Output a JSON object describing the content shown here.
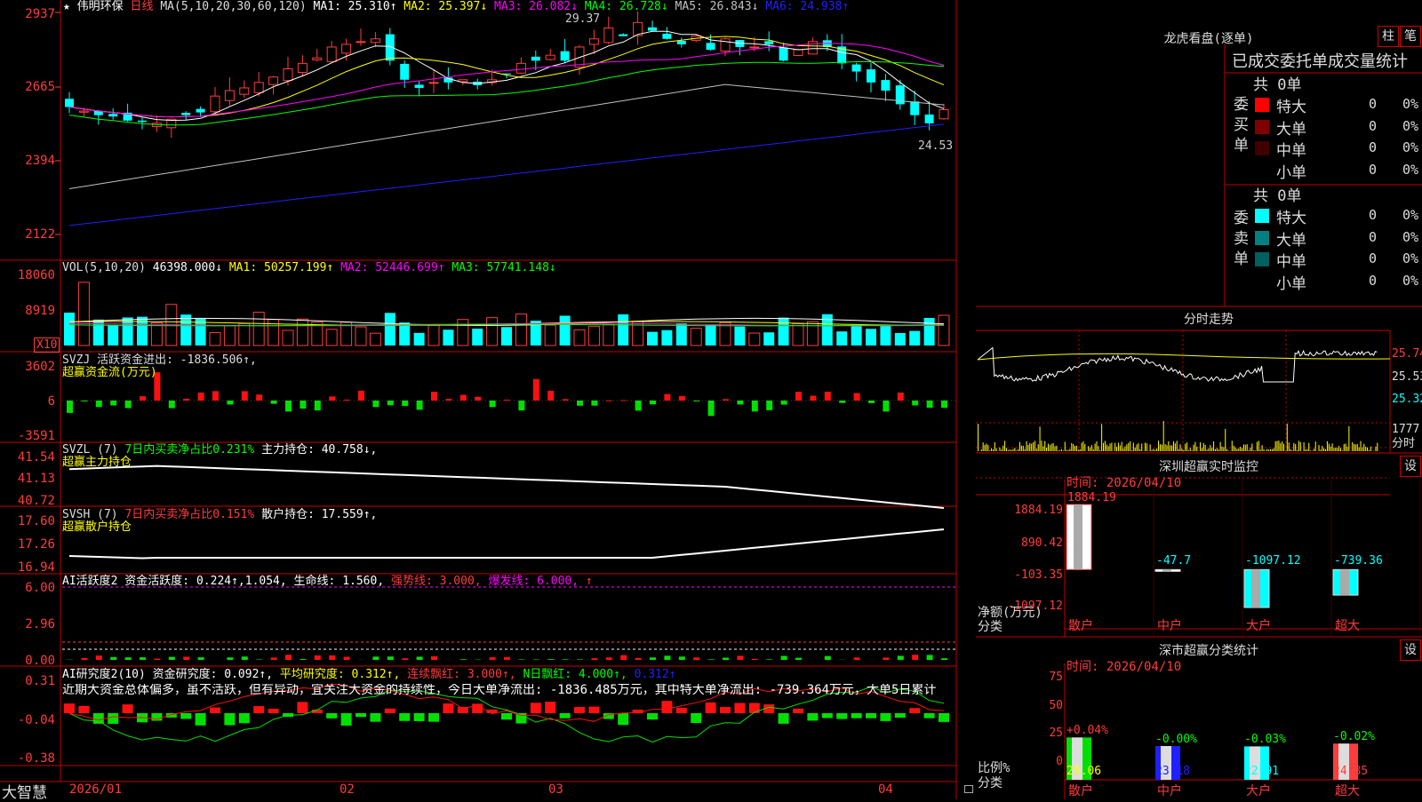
{
  "header": {
    "star": "★",
    "name": "伟明环保",
    "period": "日线",
    "ma_label": "MA(5,10,20,30,60,120)",
    "ma": [
      {
        "t": "MA1: 25.310↑",
        "c": "#ffffff"
      },
      {
        "t": "MA2: 25.397↓",
        "c": "#ffff00"
      },
      {
        "t": "MA3: 26.082↓",
        "c": "#ff00ff"
      },
      {
        "t": "MA4: 26.728↓",
        "c": "#00ff00"
      },
      {
        "t": "MA5: 26.843↓",
        "c": "#c0c0c0"
      },
      {
        "t": "MA6: 24.938↑",
        "c": "#2020ff"
      }
    ]
  },
  "price_axis": [
    "2937",
    "2665",
    "2394",
    "2122"
  ],
  "annot": {
    "high": "29.37",
    "low": "24.53"
  },
  "vol": {
    "label": "VOL(5,10,20)",
    "val": "46398.000↓",
    "ma1": "MA1: 50257.199↑",
    "ma2": "MA2: 52446.699↑",
    "ma3": "MA3: 57741.148↓",
    "axis": [
      "18060",
      "8919"
    ],
    "unit": "X10"
  },
  "svzj": {
    "l1": "SVZJ  活跃资金进出: -1836.506↑,",
    "l2": "超赢资金流(万元)",
    "axis": [
      "3602",
      "6",
      "-3591"
    ]
  },
  "svzl": {
    "l1a": "SVZL (7)",
    "l1b": "7日内买卖净占比0.231%",
    "l1c": "主力持仓: 40.758↓,",
    "l2": "超赢主力持仓",
    "axis": [
      "41.54",
      "41.13",
      "40.72"
    ]
  },
  "svsh": {
    "l1a": "SVSH (7)",
    "l1b": "7日内买卖净占比0.151%",
    "l1c": "散户持仓: 17.559↑,",
    "l2": "超赢散户持仓",
    "axis": [
      "17.60",
      "17.26",
      "16.94"
    ]
  },
  "ai1": {
    "l1": "AI活跃度2 资金活跃度: 0.224↑,1.054,",
    "l1b": "生命线: 1.560,",
    "l1c": "强势线: 3.000,",
    "l1d": "爆发线: 6.000,",
    "l1e": "↑",
    "axis": [
      "6.00",
      "2.96",
      "0.00"
    ]
  },
  "ai2": {
    "l1": "AI研究度2(10) 资金研究度: 0.092↑,",
    "l1b": "平均研究度: 0.312↑,",
    "l1c": "连续飘红: 3.000↑,",
    "l1d": "N日飘红: 4.000↑,",
    "l1e": "0.312↑",
    "text": "近期大资金总体偏多，虽不活跃，但有异动，宜关注大资金的持续性，今日大单净流出: -1836.485万元，其中特大单净流出: -739.364万元，大单5日累计",
    "axis": [
      "0.31",
      "-0.04",
      "-0.38"
    ]
  },
  "bottom": {
    "brand": "大智慧",
    "dates": [
      "2026/01",
      "02",
      "03",
      "04"
    ]
  },
  "lhb": {
    "title": "龙虎看盘(逐单)",
    "btn1": "柱",
    "btn2": "笔",
    "sub": "已成交委托单成交量统计",
    "buy": {
      "side": "委买单",
      "total": "共 0单",
      "rows": [
        {
          "n": "特大",
          "v": "0",
          "p": "0%",
          "c": "#ff0000"
        },
        {
          "n": "大单",
          "v": "0",
          "p": "0%",
          "c": "#800000"
        },
        {
          "n": "中单",
          "v": "0",
          "p": "0%",
          "c": "#400000"
        },
        {
          "n": "小单",
          "v": "0",
          "p": "0%",
          "c": "#000000"
        }
      ]
    },
    "sell": {
      "side": "委卖单",
      "total": "共 0单",
      "rows": [
        {
          "n": "特大",
          "v": "0",
          "p": "0%",
          "c": "#00ffff"
        },
        {
          "n": "大单",
          "v": "0",
          "p": "0%",
          "c": "#008080"
        },
        {
          "n": "中单",
          "v": "0",
          "p": "0%",
          "c": "#006060"
        },
        {
          "n": "小单",
          "v": "0",
          "p": "0%",
          "c": "#000000"
        }
      ]
    }
  },
  "fs": {
    "title": "分时走势",
    "axis": [
      "25.74",
      "25.53",
      "25.32"
    ],
    "vol": "1777",
    "vlabel": "分时"
  },
  "sz1": {
    "title": "深圳超赢实时监控",
    "btn": "设",
    "time": "时间: 2026/04/10",
    "axis": [
      "1884.19",
      "890.42",
      "-103.35",
      "-1097.12"
    ],
    "ylabel1": "净额(万元)",
    "ylabel2": "分类",
    "cats": [
      "散户",
      "中户",
      "大户",
      "超大"
    ],
    "vals": [
      "1884.19",
      "-47.7",
      "-1097.12",
      "-739.36"
    ],
    "chart_data": {
      "type": "bar",
      "categories": [
        "散户",
        "中户",
        "大户",
        "超大"
      ],
      "values": [
        1884.19,
        -47.7,
        -1097.12,
        -739.36
      ],
      "ylabel": "净额(万元)",
      "ylim": [
        -1097.12,
        1884.19
      ]
    }
  },
  "sz2": {
    "title": "深市超赢分类统计",
    "btn": "设",
    "time": "时间: 2026/04/10",
    "axis": [
      "75",
      "50",
      "25",
      "0"
    ],
    "ylabel1": "比例%",
    "ylabel2": "分类",
    "cats": [
      "散户",
      "中户",
      "大户",
      "超大"
    ],
    "vals": [
      "29.06",
      "23.18",
      "22.91",
      "24.85"
    ],
    "chg": [
      "+0.04%",
      "-0.00%",
      "-0.03%",
      "-0.02%"
    ],
    "chart_data": {
      "type": "bar",
      "categories": [
        "散户",
        "中户",
        "大户",
        "超大"
      ],
      "values": [
        29.06,
        23.18,
        22.91,
        24.85
      ],
      "ylabel": "比例%",
      "ylim": [
        0,
        75
      ]
    }
  },
  "chart_data": {
    "type": "candlestick",
    "title": "伟明环保 日线",
    "dates": [
      "2026/01",
      "02",
      "03",
      "04"
    ],
    "ylim": [
      21.22,
      29.37
    ],
    "high": 29.37,
    "low": 24.53,
    "ma_last": {
      "MA1": 25.31,
      "MA2": 25.397,
      "MA3": 26.082,
      "MA4": 26.728,
      "MA5": 26.843,
      "MA6": 24.938
    }
  }
}
